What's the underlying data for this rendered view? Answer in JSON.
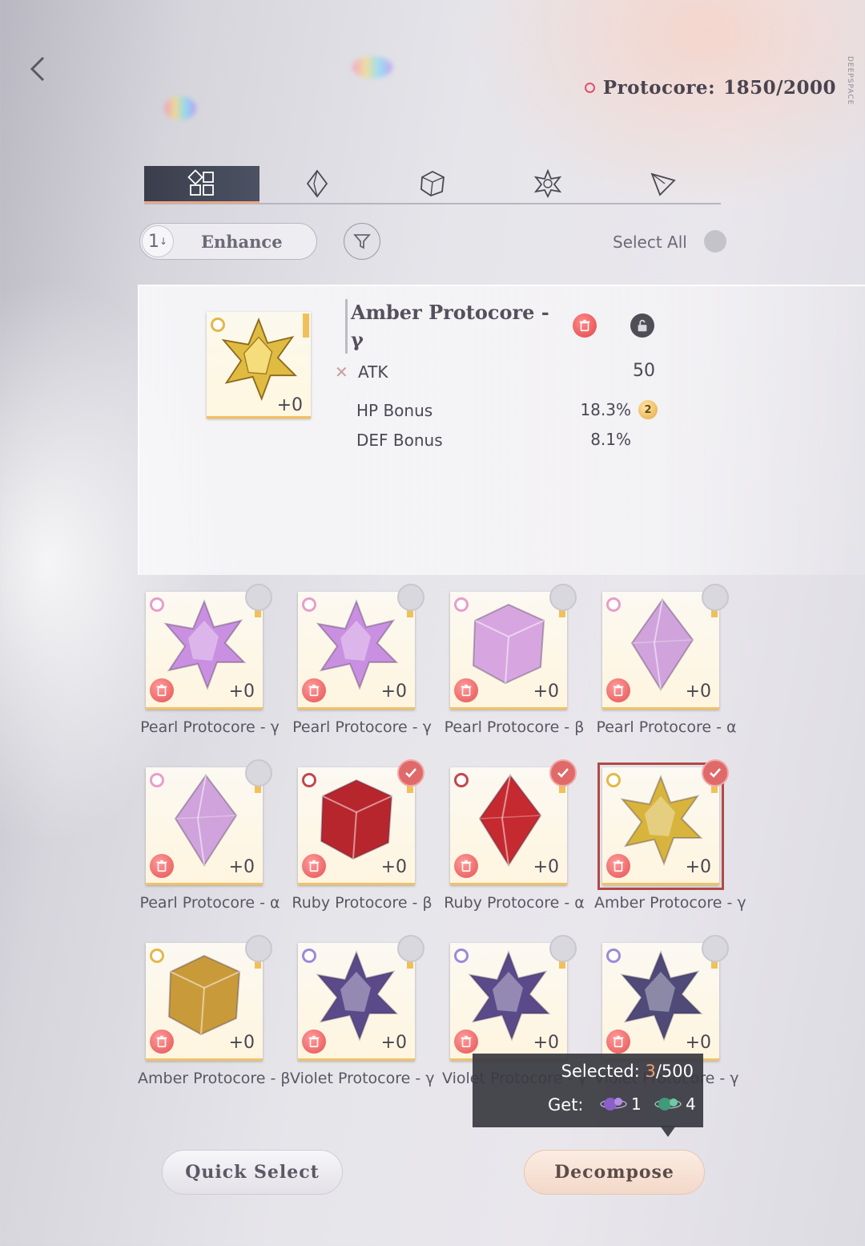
{
  "header": {
    "back_label": "",
    "protocore_label": "Protocore:",
    "protocore_count": "1850/2000",
    "brand": "DEEPSPACE"
  },
  "tabs": [
    {
      "icon": "grid-icon",
      "active": true
    },
    {
      "icon": "diamond-icon",
      "active": false
    },
    {
      "icon": "cube-icon",
      "active": false
    },
    {
      "icon": "star-polyhedron-icon",
      "active": false
    },
    {
      "icon": "triangle-icon",
      "active": false
    }
  ],
  "controls": {
    "sort_number": "1",
    "sort_label": "Enhance",
    "select_all_label": "Select All"
  },
  "detail": {
    "title": "Amber Protocore - γ",
    "level": "+0",
    "main_stat": {
      "label": "ATK",
      "value": "50"
    },
    "sub_stats": [
      {
        "label": "HP Bonus",
        "value": "18.3%",
        "badge": "2"
      },
      {
        "label": "DEF Bonus",
        "value": "8.1%"
      }
    ]
  },
  "items": [
    {
      "name": "Pearl Protocore - γ",
      "level": "+0",
      "selected": false,
      "shape": "star",
      "color": "#c98fe0",
      "rarity": "#e79ec9"
    },
    {
      "name": "Pearl Protocore - γ",
      "level": "+0",
      "selected": false,
      "shape": "star",
      "color": "#c98fe0",
      "rarity": "#e79ec9"
    },
    {
      "name": "Pearl Protocore - β",
      "level": "+0",
      "selected": false,
      "shape": "cube",
      "color": "#d7a6e0",
      "rarity": "#e79ec9"
    },
    {
      "name": "Pearl Protocore - α",
      "level": "+0",
      "selected": false,
      "shape": "diamond",
      "color": "#d0a3dc",
      "rarity": "#e79ec9"
    },
    {
      "name": "Pearl Protocore - α",
      "level": "+0",
      "selected": false,
      "shape": "diamond",
      "color": "#d0a3dc",
      "rarity": "#e79ec9"
    },
    {
      "name": "Ruby Protocore - β",
      "level": "+0",
      "selected": true,
      "shape": "cube",
      "color": "#b8262d",
      "rarity": "#c4464a"
    },
    {
      "name": "Ruby Protocore - α",
      "level": "+0",
      "selected": true,
      "shape": "diamond",
      "color": "#c52a30",
      "rarity": "#c4464a"
    },
    {
      "name": "Amber Protocore - γ",
      "level": "+0",
      "selected": true,
      "shape": "star",
      "color": "#d8b43c",
      "rarity": "#e2b84a",
      "highlight": true
    },
    {
      "name": "Amber Protocore - β",
      "level": "+0",
      "selected": false,
      "shape": "cube",
      "color": "#c99a3a",
      "rarity": "#e2b84a"
    },
    {
      "name": "Violet Protocore - γ",
      "level": "+0",
      "selected": false,
      "shape": "star",
      "color": "#5b4a8a",
      "rarity": "#9a8ad8"
    },
    {
      "name": "Violet Protocore - γ",
      "level": "+0",
      "selected": false,
      "shape": "star",
      "color": "#5b4a8a",
      "rarity": "#9a8ad8"
    },
    {
      "name": "Violet Protocore - γ",
      "level": "+0",
      "selected": false,
      "shape": "star",
      "color": "#4f4a78",
      "rarity": "#9a8ad8"
    }
  ],
  "tooltip": {
    "selected_label": "Selected:",
    "selected_count": "3",
    "selected_max": "/500",
    "get_label": "Get:",
    "rewards": [
      {
        "icon": "purple-orb-icon",
        "count": "1"
      },
      {
        "icon": "green-orb-icon",
        "count": "4"
      }
    ]
  },
  "buttons": {
    "quick_select": "Quick Select",
    "decompose": "Decompose"
  }
}
